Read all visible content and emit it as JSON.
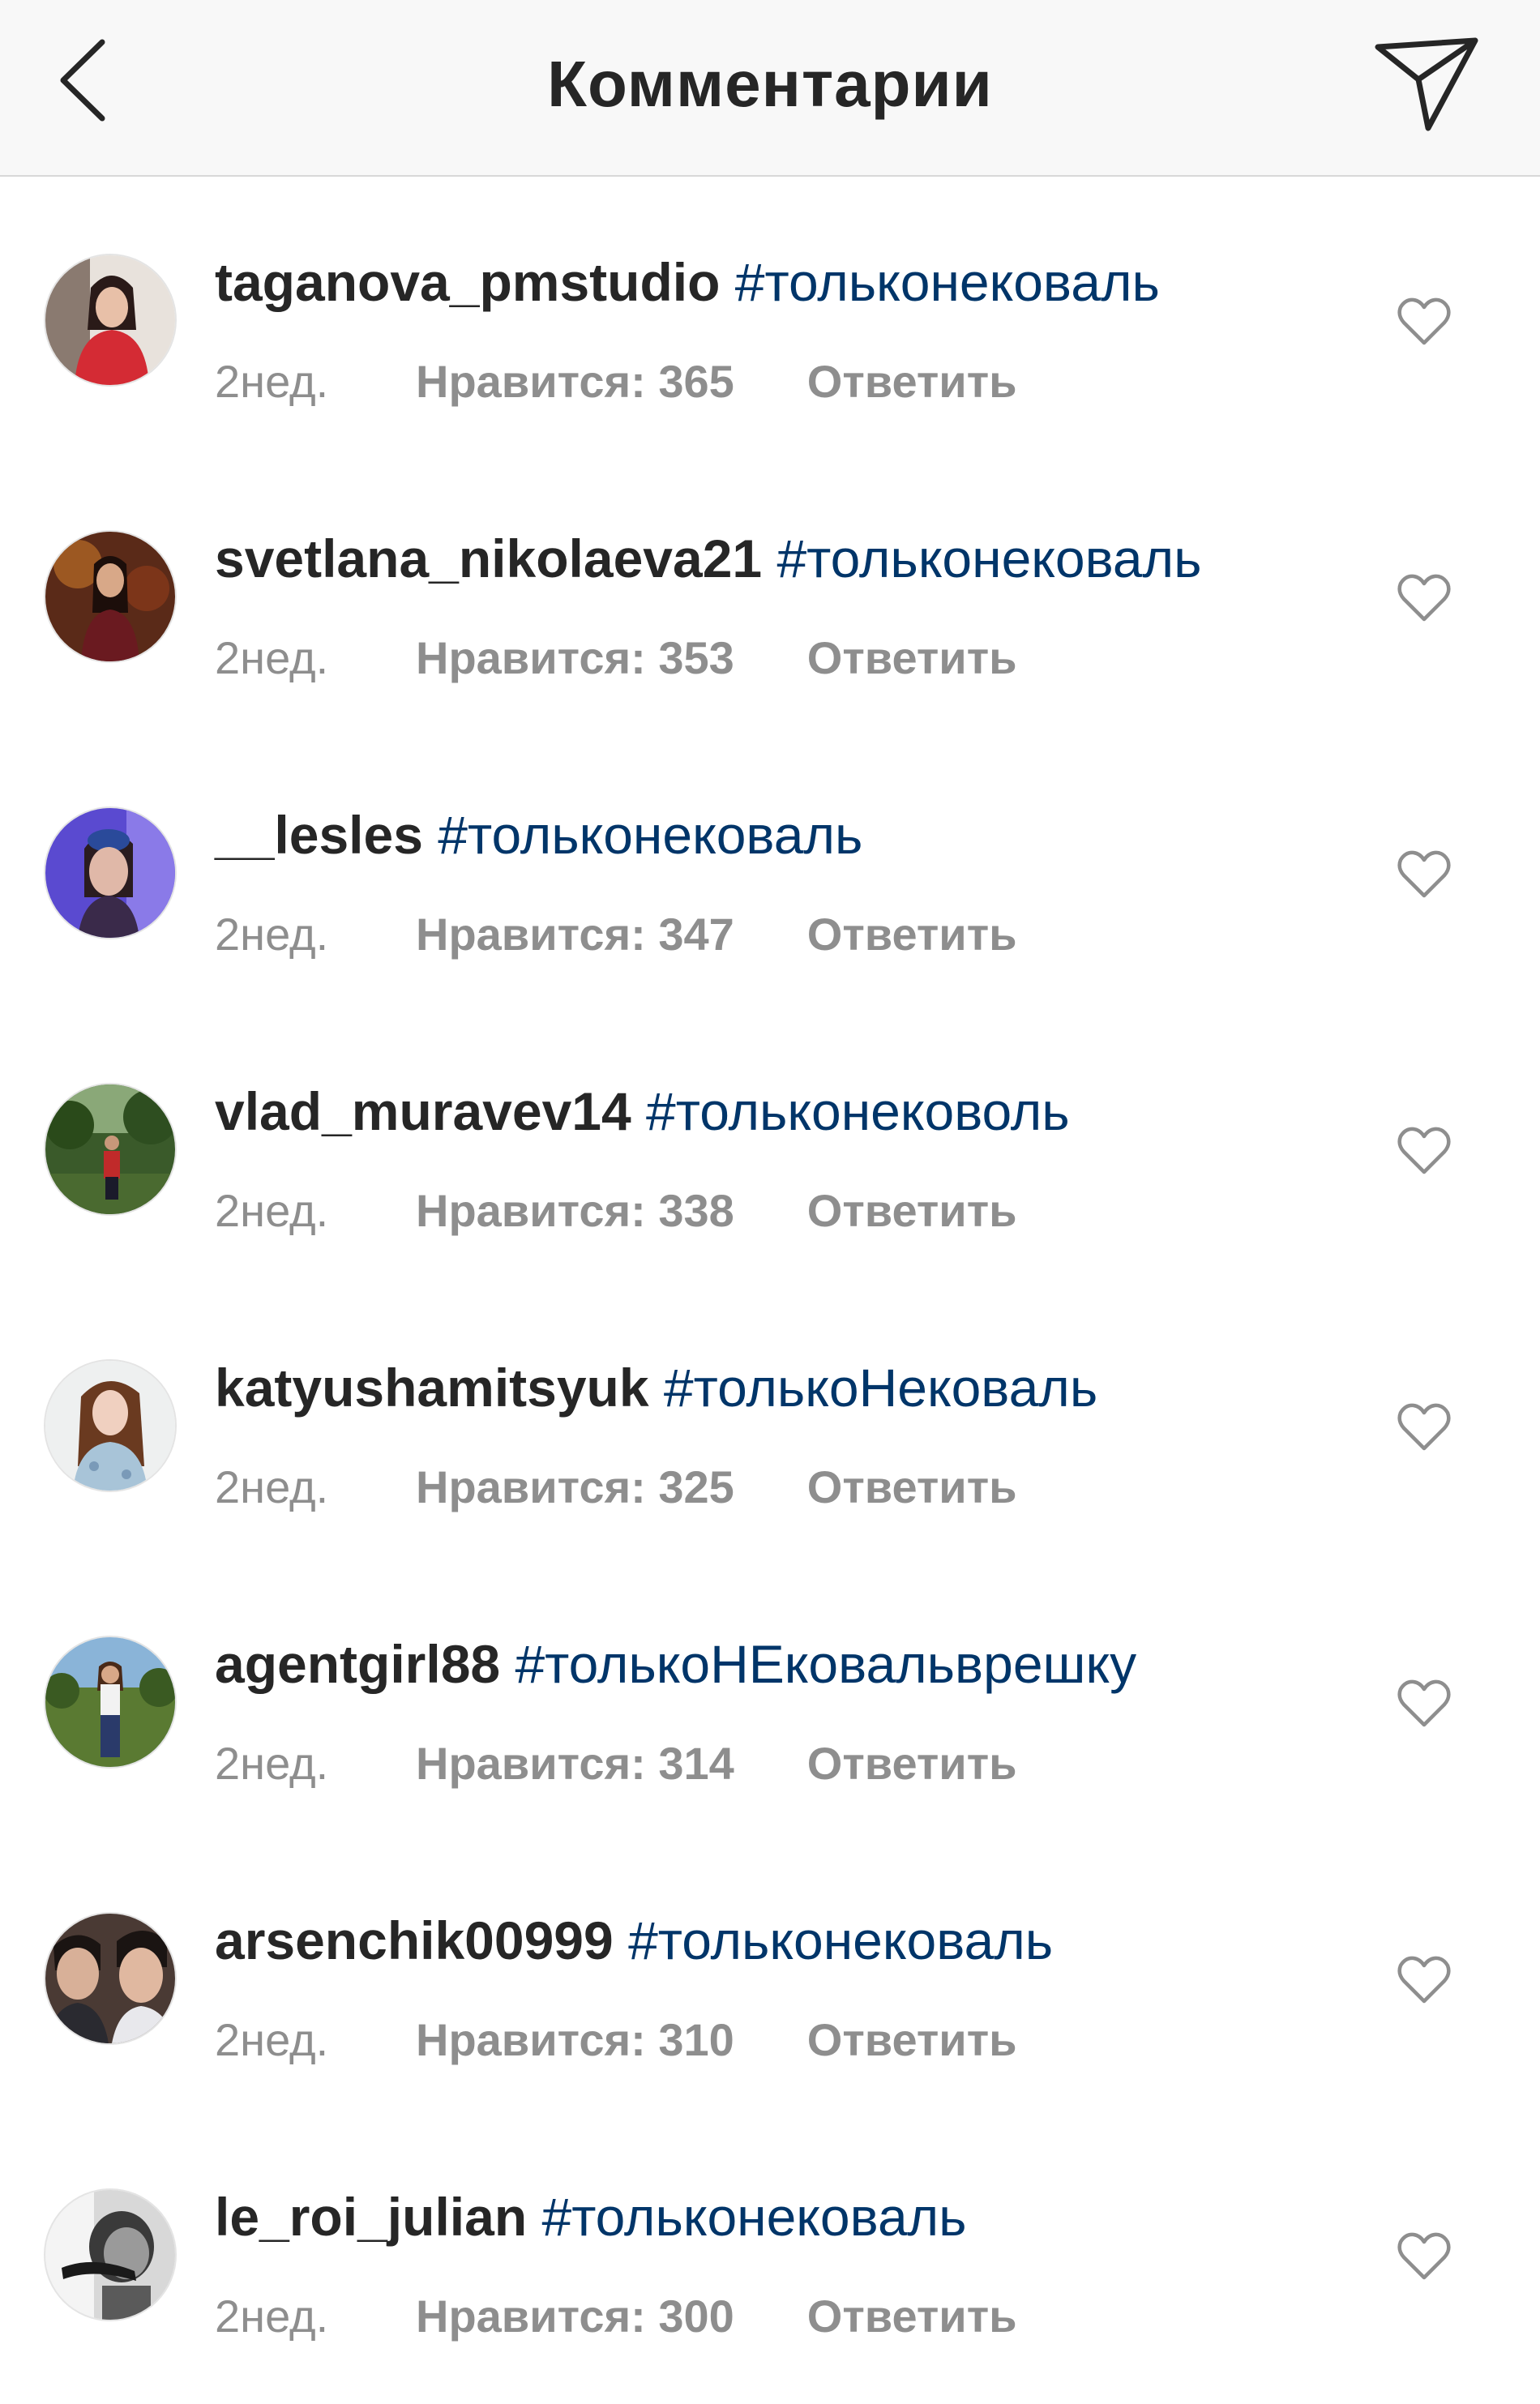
{
  "header": {
    "title": "Комментарии"
  },
  "comments": [
    {
      "username": "taganova_pmstudio",
      "hashtag": "#тольконековаль",
      "time": "2нед.",
      "likes": "Нравится: 365",
      "reply": "Ответить"
    },
    {
      "username": "svetlana_nikolaeva21",
      "hashtag": "#тольконековаль",
      "time": "2нед.",
      "likes": "Нравится: 353",
      "reply": "Ответить"
    },
    {
      "username": "__lesles",
      "hashtag": "#тольконековаль",
      "time": "2нед.",
      "likes": "Нравится: 347",
      "reply": "Ответить"
    },
    {
      "username": "vlad_muravev14",
      "hashtag": "#тольконековоль",
      "time": "2нед.",
      "likes": "Нравится: 338",
      "reply": "Ответить"
    },
    {
      "username": "katyushamitsyuk",
      "hashtag": "#толькоНековаль",
      "time": "2нед.",
      "likes": "Нравится: 325",
      "reply": "Ответить"
    },
    {
      "username": "agentgirl88",
      "hashtag": "#толькоНЕковальврешку",
      "time": "2нед.",
      "likes": "Нравится: 314",
      "reply": "Ответить"
    },
    {
      "username": "arsenchik00999",
      "hashtag": "#тольконековаль",
      "time": "2нед.",
      "likes": "Нравится: 310",
      "reply": "Ответить"
    },
    {
      "username": "le_roi_julian",
      "hashtag": "#тольконековаль",
      "time": "2нед.",
      "likes": "Нравится: 300",
      "reply": "Ответить"
    }
  ],
  "colors": {
    "hashtag": "#003569",
    "meta": "#8e8e8e",
    "text": "#262626",
    "header_bg": "#f8f8f8"
  },
  "icons": {
    "back": "chevron-left-icon",
    "share": "send-icon",
    "like": "heart-outline-icon"
  }
}
